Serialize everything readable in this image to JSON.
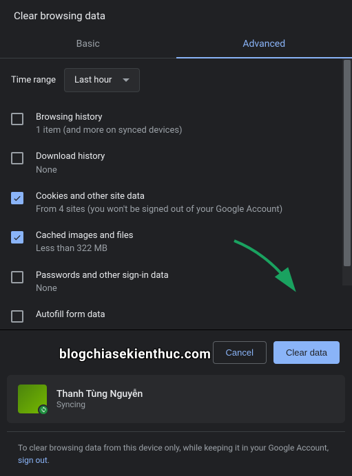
{
  "title": "Clear browsing data",
  "tabs": {
    "basic": "Basic",
    "advanced": "Advanced",
    "activeIndex": 1
  },
  "timeRange": {
    "label": "Time range",
    "value": "Last hour"
  },
  "options": [
    {
      "checked": false,
      "title": "Browsing history",
      "sub": "1 item (and more on synced devices)"
    },
    {
      "checked": false,
      "title": "Download history",
      "sub": "None"
    },
    {
      "checked": true,
      "title": "Cookies and other site data",
      "sub": "From 4 sites (you won't be signed out of your Google Account)"
    },
    {
      "checked": true,
      "title": "Cached images and files",
      "sub": "Less than 322 MB"
    },
    {
      "checked": false,
      "title": "Passwords and other sign-in data",
      "sub": "None"
    },
    {
      "checked": false,
      "title": "Autofill form data",
      "sub": ""
    }
  ],
  "actions": {
    "cancel": "Cancel",
    "clear": "Clear data"
  },
  "profile": {
    "name": "Thanh Tùng Nguyễn",
    "status": "Syncing "
  },
  "footer": {
    "text": "To clear browsing data from this device only, while keeping it in your Google Account, ",
    "link": "sign out",
    "suffix": "."
  },
  "watermark": "blogchiasekienthuc.com"
}
